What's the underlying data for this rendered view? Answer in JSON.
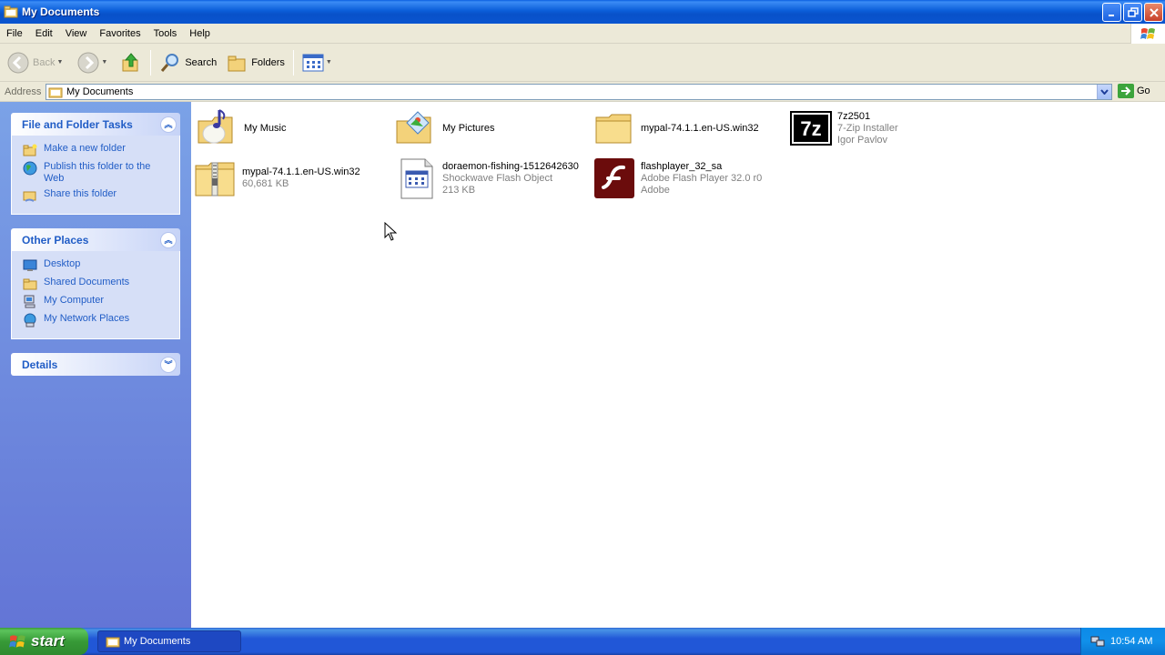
{
  "window": {
    "title": "My Documents"
  },
  "menu": [
    "File",
    "Edit",
    "View",
    "Favorites",
    "Tools",
    "Help"
  ],
  "toolbar": {
    "back": "Back",
    "search": "Search",
    "folders": "Folders"
  },
  "address": {
    "label": "Address",
    "value": "My Documents",
    "go": "Go"
  },
  "left_pane": {
    "file_tasks": {
      "title": "File and Folder Tasks",
      "items": [
        "Make a new folder",
        "Publish this folder to the Web",
        "Share this folder"
      ]
    },
    "other_places": {
      "title": "Other Places",
      "items": [
        "Desktop",
        "Shared Documents",
        "My Computer",
        "My Network Places"
      ]
    },
    "details": {
      "title": "Details"
    }
  },
  "files": [
    {
      "name": "My Music",
      "icon": "music-folder-icon"
    },
    {
      "name": "My Pictures",
      "icon": "pictures-folder-icon"
    },
    {
      "name": "mypal-74.1.1.en-US.win32",
      "icon": "folder-icon"
    },
    {
      "name": "7z2501",
      "line2": "7-Zip Installer",
      "line3": "Igor Pavlov",
      "icon": "7zip-icon"
    },
    {
      "name": "mypal-74.1.1.en-US.win32",
      "line2": "60,681 KB",
      "icon": "zip-folder-icon"
    },
    {
      "name": "doraemon-fishing-1512642630",
      "line2": "Shockwave Flash Object",
      "line3": "213 KB",
      "icon": "swf-file-icon"
    },
    {
      "name": "flashplayer_32_sa",
      "line2": "Adobe Flash Player 32.0 r0",
      "line3": "Adobe",
      "icon": "flash-player-icon"
    }
  ],
  "taskbar": {
    "start": "start",
    "window_button": "My Documents",
    "clock": "10:54 AM"
  }
}
